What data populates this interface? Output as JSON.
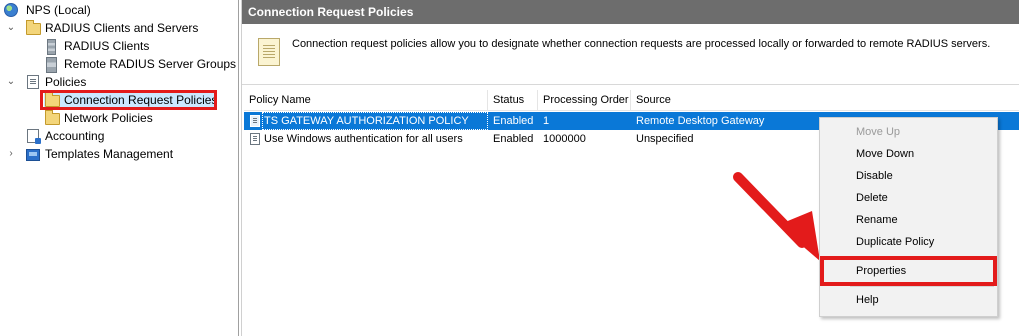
{
  "tree": {
    "root": {
      "label": "NPS (Local)",
      "icon": "globe-icon"
    },
    "items": [
      {
        "label": "RADIUS Clients and Servers",
        "icon": "folder-icon",
        "expanded": true
      },
      {
        "label": "RADIUS Clients",
        "icon": "server-icon"
      },
      {
        "label": "Remote RADIUS Server Groups",
        "icon": "server-group-icon"
      },
      {
        "label": "Policies",
        "icon": "policy-doc-icon",
        "expanded": true
      },
      {
        "label": "Connection Request Policies",
        "icon": "folder-open-icon",
        "selected": true
      },
      {
        "label": "Network Policies",
        "icon": "folder-icon"
      },
      {
        "label": "Accounting",
        "icon": "accounting-icon"
      },
      {
        "label": "Templates Management",
        "icon": "templates-icon",
        "expanded": false
      }
    ]
  },
  "panel": {
    "title": "Connection Request Policies",
    "info_text": "Connection request policies allow you to designate whether connection requests are processed locally or forwarded to remote RADIUS servers."
  },
  "table": {
    "columns": [
      "Policy Name",
      "Status",
      "Processing Order",
      "Source"
    ],
    "rows": [
      {
        "name": "TS GATEWAY AUTHORIZATION POLICY",
        "status": "Enabled",
        "order": "1",
        "source": "Remote Desktop Gateway",
        "selected": true
      },
      {
        "name": "Use Windows authentication for all users",
        "status": "Enabled",
        "order": "1000000",
        "source": "Unspecified",
        "selected": false
      }
    ]
  },
  "context_menu": {
    "items": [
      {
        "label": "Move Up",
        "disabled": true
      },
      {
        "label": "Move Down",
        "disabled": false
      },
      {
        "label": "Disable",
        "disabled": false
      },
      {
        "label": "Delete",
        "disabled": false
      },
      {
        "label": "Rename",
        "disabled": false
      },
      {
        "label": "Duplicate Policy",
        "disabled": false
      },
      {
        "label": "Properties",
        "disabled": false,
        "highlighted": true
      },
      {
        "label": "Help",
        "disabled": false
      }
    ]
  },
  "colors": {
    "highlight_red": "#e31b1b",
    "selection_blue": "#0a78d7",
    "header_gray": "#6d6d6d"
  }
}
